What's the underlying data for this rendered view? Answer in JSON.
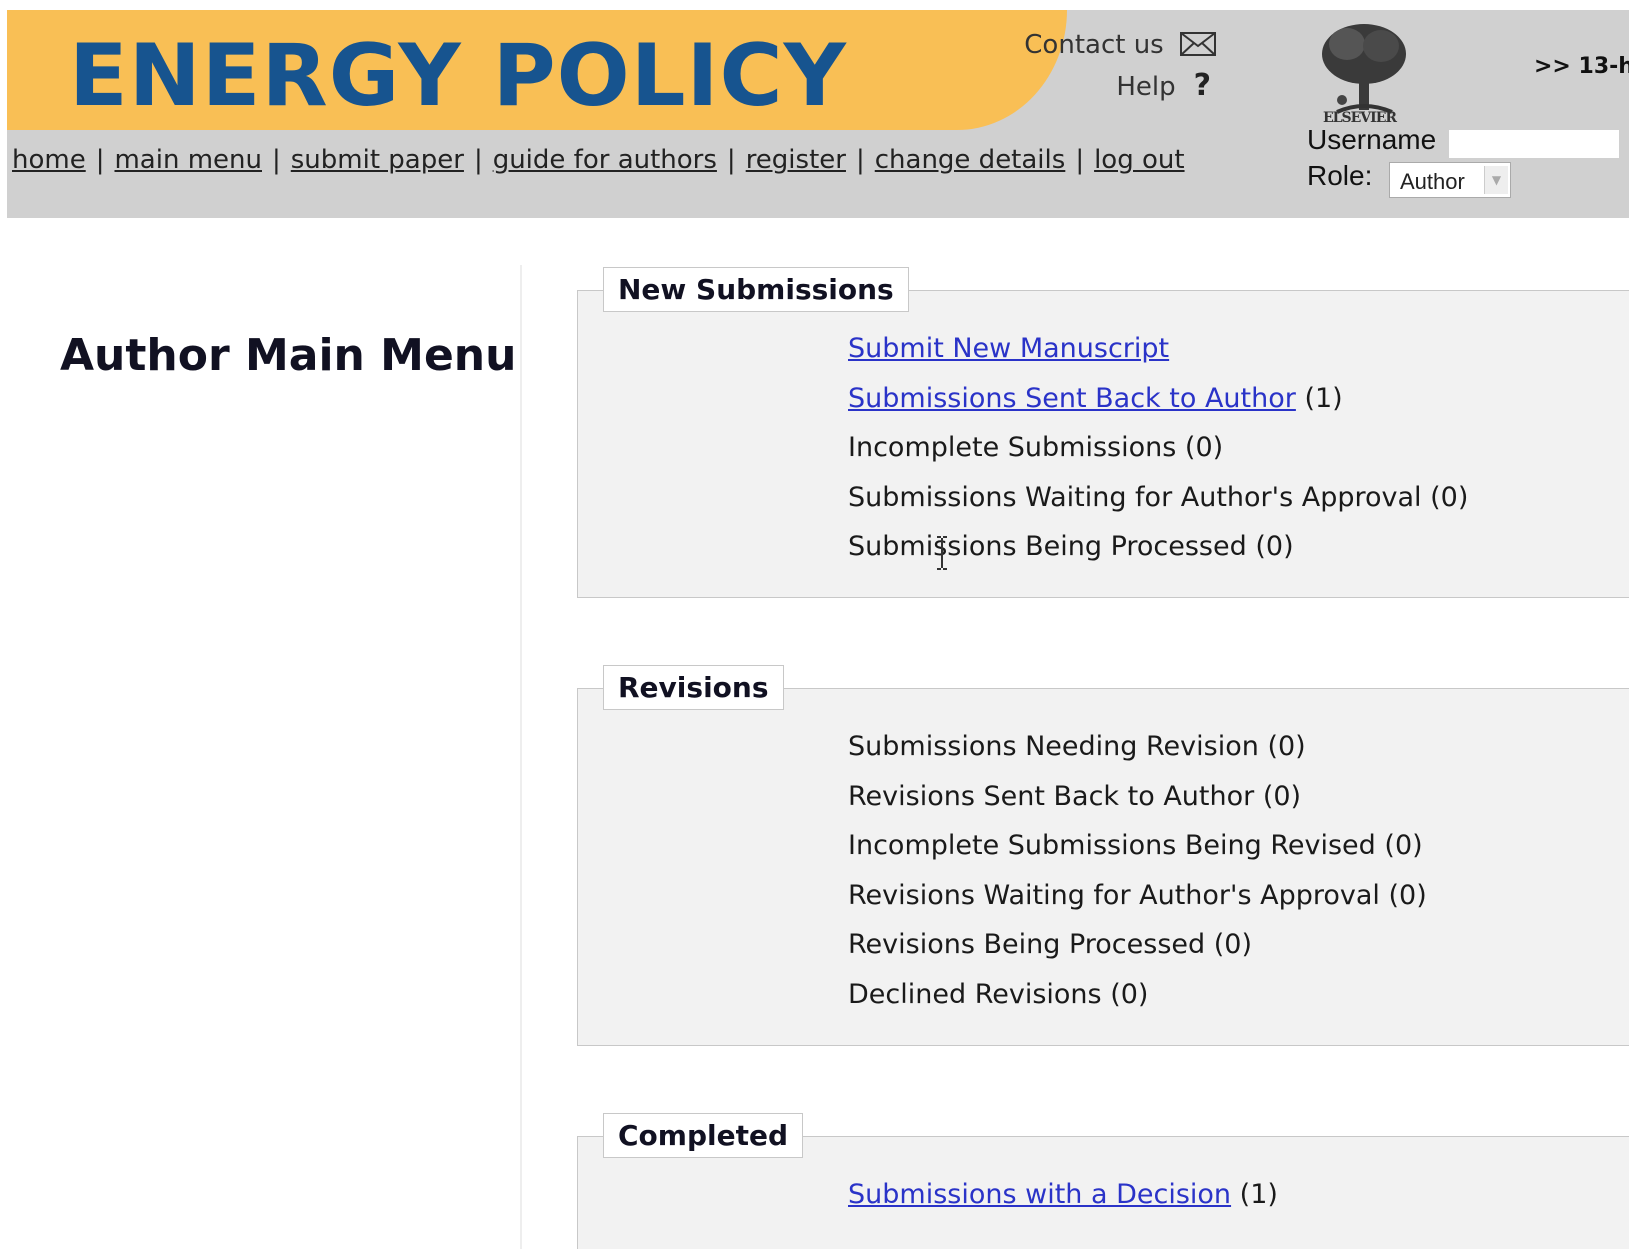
{
  "header": {
    "journal_title": "ENERGY POLICY",
    "contact_label": "Contact us",
    "help_label": "Help",
    "help_symbol": "?",
    "publisher_logo_text": "ELSEVIER",
    "date_text": ">> 13-h",
    "nav": [
      "home",
      "main menu",
      "submit paper",
      "guide for authors",
      "register",
      "change details",
      "log out"
    ],
    "username_label": "Username",
    "username_value": "",
    "role_label": "Role:",
    "role_value": "Author"
  },
  "page": {
    "title": "Author Main Menu"
  },
  "sections": {
    "new_submissions": {
      "title": "New Submissions",
      "items": [
        {
          "label": "Submit New Manuscript",
          "count": "",
          "link": true
        },
        {
          "label": "Submissions Sent Back to Author",
          "count": "(1)",
          "link": true
        },
        {
          "label": "Incomplete Submissions",
          "count": "(0)",
          "link": false
        },
        {
          "label": "Submissions Waiting for Author's Approval",
          "count": "(0)",
          "link": false
        },
        {
          "label": "Submissions Being Processed",
          "count": "(0)",
          "link": false
        }
      ]
    },
    "revisions": {
      "title": "Revisions",
      "items": [
        {
          "label": "Submissions Needing Revision",
          "count": "(0)",
          "link": false
        },
        {
          "label": "Revisions Sent Back to Author",
          "count": "(0)",
          "link": false
        },
        {
          "label": "Incomplete Submissions Being Revised",
          "count": "(0)",
          "link": false
        },
        {
          "label": "Revisions Waiting for Author's Approval",
          "count": "(0)",
          "link": false
        },
        {
          "label": "Revisions Being Processed",
          "count": "(0)",
          "link": false
        },
        {
          "label": "Declined Revisions",
          "count": "(0)",
          "link": false
        }
      ]
    },
    "completed": {
      "title": "Completed",
      "items": [
        {
          "label": "Submissions with a Decision",
          "count": "(1)",
          "link": true
        }
      ]
    }
  },
  "colors": {
    "banner": "#f9bf55",
    "title_blue": "#17548f",
    "header_gray": "#d0d0d0",
    "link_blue": "#2a33c8",
    "section_bg": "#f2f2f2"
  },
  "icons": [
    "mail-icon",
    "help-icon",
    "elsevier-tree-logo",
    "chevron-down-icon",
    "text-cursor-icon"
  ]
}
